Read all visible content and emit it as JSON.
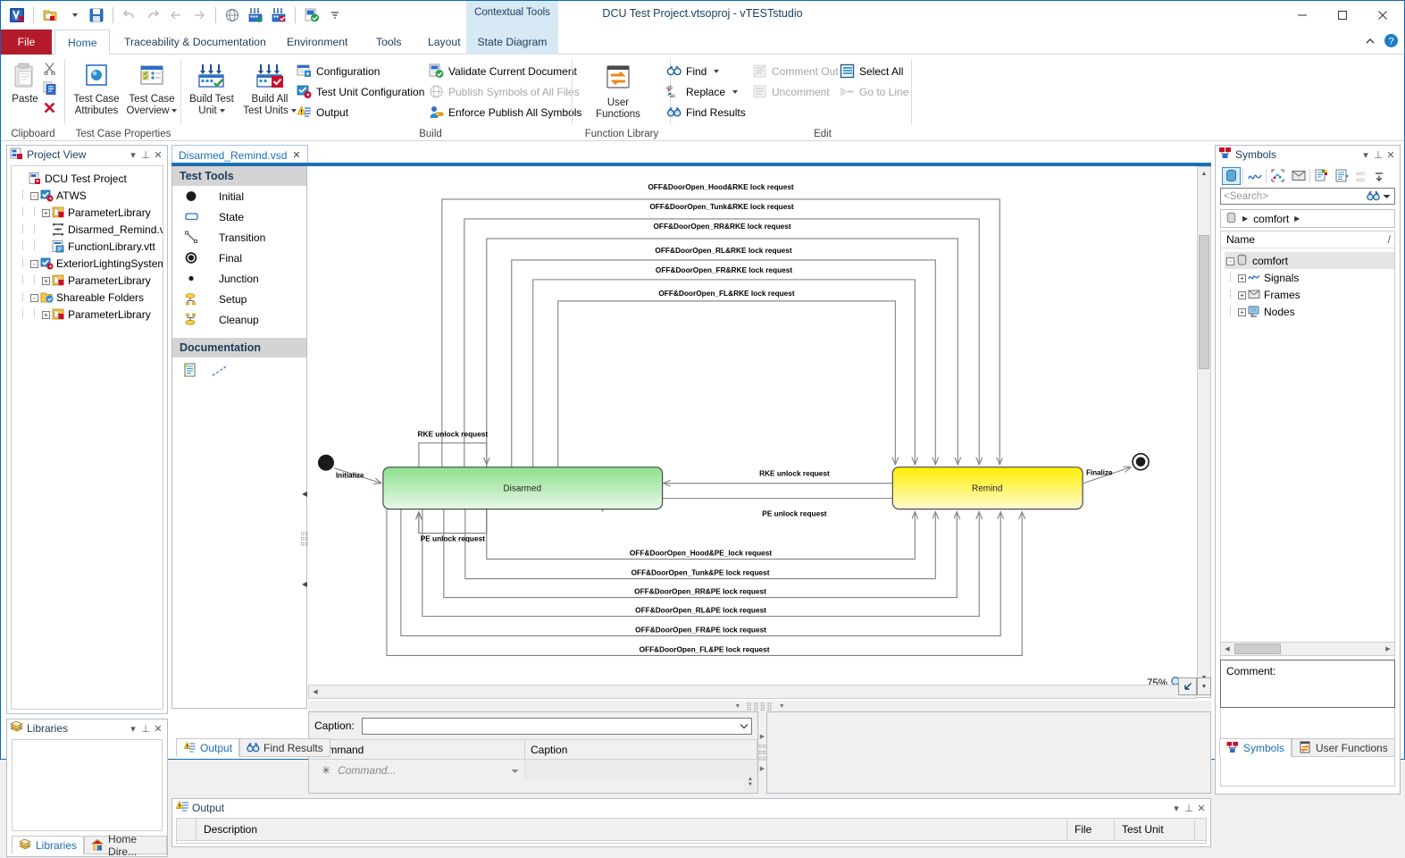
{
  "window": {
    "title": "DCU Test Project.vtsoproj - vTESTstudio",
    "contextual_tools": "Contextual Tools",
    "minimize": "—",
    "maximize": "☐",
    "close": "✕",
    "collapse_ribbon": "⌃",
    "help": "?"
  },
  "quick_access": [
    {
      "name": "app-logo-icon",
      "label": "vTESTstudio"
    },
    {
      "name": "open-project-icon",
      "label": "Open Project"
    },
    {
      "name": "save-icon",
      "label": "Save"
    },
    {
      "name": "undo-icon",
      "label": "Undo"
    },
    {
      "name": "redo-icon",
      "label": "Redo"
    },
    {
      "name": "back-icon",
      "label": "Back"
    },
    {
      "name": "forward-icon",
      "label": "Forward"
    },
    {
      "name": "publish-symbols-icon",
      "label": "Publish Symbols"
    },
    {
      "name": "build-test-unit-icon",
      "label": "Build Test Unit"
    },
    {
      "name": "build-all-test-units-icon",
      "label": "Build All Test Units"
    },
    {
      "name": "new-document-icon",
      "label": "New Document"
    },
    {
      "name": "customize-qat-icon",
      "label": "Customize Quick Access Toolbar"
    }
  ],
  "ribbon_tabs": [
    {
      "label": "File",
      "state": "file"
    },
    {
      "label": "Home",
      "state": "active"
    },
    {
      "label": "Traceability & Documentation",
      "state": "normal"
    },
    {
      "label": "Environment",
      "state": "normal"
    },
    {
      "label": "Tools",
      "state": "normal"
    },
    {
      "label": "Layout",
      "state": "normal"
    },
    {
      "label": "State Diagram",
      "state": "contextual"
    }
  ],
  "ribbon_groups": {
    "clipboard": {
      "label": "Clipboard",
      "paste": "Paste",
      "cut": "Cut",
      "copy": "Copy",
      "delete": "Delete"
    },
    "test_case_properties": {
      "label": "Test Case Properties",
      "items": [
        {
          "line1": "Test Case",
          "line2": "Attributes",
          "dropdown": false
        },
        {
          "line1": "Test Case",
          "line2": "Overview",
          "dropdown": true
        }
      ]
    },
    "build": {
      "label": "Build",
      "big": [
        {
          "line1": "Build Test",
          "line2": "Unit",
          "dropdown": true
        },
        {
          "line1": "Build All",
          "line2": "Test Units",
          "dropdown": true
        }
      ],
      "col1": [
        {
          "label": "Configuration",
          "icon": "configuration-icon",
          "disabled": false
        },
        {
          "label": "Test Unit Configuration",
          "icon": "test-unit-configuration-icon",
          "disabled": false
        },
        {
          "label": "Output",
          "icon": "output-icon",
          "disabled": false
        }
      ],
      "col2": [
        {
          "label": "Validate Current Document",
          "icon": "validate-icon",
          "disabled": false
        },
        {
          "label": "Publish Symbols of All Files",
          "icon": "publish-symbols-icon",
          "disabled": true
        },
        {
          "label": "Enforce Publish All Symbols",
          "icon": "enforce-publish-icon",
          "disabled": false
        }
      ]
    },
    "function_library": {
      "label": "Function Library",
      "user_functions_line1": "User",
      "user_functions_line2": "Functions"
    },
    "edit": {
      "label": "Edit",
      "col1": [
        {
          "label": "Find",
          "icon": "find-icon",
          "disabled": false,
          "dropdown": true
        },
        {
          "label": "Replace",
          "icon": "replace-icon",
          "disabled": false,
          "dropdown": true
        },
        {
          "label": "Find Results",
          "icon": "find-results-icon",
          "disabled": false,
          "dropdown": false
        }
      ],
      "col2": [
        {
          "label": "Comment Out",
          "icon": "comment-out-icon",
          "disabled": true
        },
        {
          "label": "Uncomment",
          "icon": "uncomment-icon",
          "disabled": true
        }
      ],
      "col3": [
        {
          "label": "Select All",
          "icon": "select-all-icon",
          "disabled": false
        },
        {
          "label": "Go to Line",
          "icon": "go-to-line-icon",
          "disabled": true
        }
      ]
    }
  },
  "project_view": {
    "title": "Project View",
    "nodes": [
      {
        "label": "DCU Test Project",
        "indent": 0,
        "expander": "",
        "icon": "project-icon"
      },
      {
        "label": "ATWS",
        "indent": 1,
        "expander": "-",
        "icon": "test-unit-icon"
      },
      {
        "label": "ParameterLibrary",
        "indent": 2,
        "expander": "+",
        "icon": "parameter-library-icon"
      },
      {
        "label": "Disarmed_Remind.vsd",
        "indent": 2,
        "expander": "",
        "icon": "state-diagram-icon"
      },
      {
        "label": "FunctionLibrary.vtt",
        "indent": 2,
        "expander": "",
        "icon": "test-table-icon"
      },
      {
        "label": "ExteriorLightingSystem",
        "indent": 1,
        "expander": "-",
        "icon": "test-unit-icon"
      },
      {
        "label": "ParameterLibrary",
        "indent": 2,
        "expander": "+",
        "icon": "parameter-library-icon"
      },
      {
        "label": "Shareable Folders",
        "indent": 1,
        "expander": "-",
        "icon": "shareable-folders-icon"
      },
      {
        "label": "ParameterLibrary",
        "indent": 2,
        "expander": "+",
        "icon": "parameter-library-icon"
      }
    ]
  },
  "libraries_panel": {
    "title": "Libraries",
    "tabs": [
      {
        "label": "Libraries",
        "icon": "libraries-icon",
        "active": true
      },
      {
        "label": "Home Dire...",
        "icon": "home-directory-icon",
        "active": false
      }
    ]
  },
  "document": {
    "tab_label": "Disarmed_Remind.vsd",
    "tab_close": "✕"
  },
  "test_tools": {
    "header": "Test Tools",
    "items": [
      {
        "label": "Initial",
        "icon": "initial-state-icon"
      },
      {
        "label": "State",
        "icon": "state-icon"
      },
      {
        "label": "Transition",
        "icon": "transition-icon"
      },
      {
        "label": "Final",
        "icon": "final-state-icon"
      },
      {
        "label": "Junction",
        "icon": "junction-icon"
      },
      {
        "label": "Setup",
        "icon": "setup-icon"
      },
      {
        "label": "Cleanup",
        "icon": "cleanup-icon"
      }
    ],
    "documentation_header": "Documentation",
    "documentation_items": [
      {
        "icon": "note-icon",
        "label": "Note"
      },
      {
        "icon": "connector-icon",
        "label": "Connector"
      }
    ]
  },
  "canvas": {
    "zoom_level": "75%",
    "zoom_icon": "magnifier-icon",
    "fit_icon": "fit-page-icon",
    "dropdown_icon": "chevron-down-icon"
  },
  "diagram": {
    "states": [
      {
        "name": "Disarmed",
        "fill": "#8fe08f"
      },
      {
        "name": "Remind",
        "fill": "#ffee00"
      }
    ],
    "pseudostates": [
      {
        "label": "Initialize",
        "type": "initial"
      },
      {
        "label": "Finalize",
        "type": "final"
      }
    ],
    "self_transitions": [
      {
        "label": "RKE unlock request",
        "on": "Disarmed",
        "side": "top"
      },
      {
        "label": "PE unlock request",
        "on": "Disarmed",
        "side": "bottom"
      }
    ],
    "remind_to_disarmed": [
      "RKE unlock request",
      "PE unlock request"
    ],
    "disarmed_to_remind_top": [
      "OFF&DoorOpen_Hood&RKE lock request",
      "OFF&DoorOpen_Tunk&RKE lock request",
      "OFF&DoorOpen_RR&RKE lock request",
      "OFF&DoorOpen_RL&RKE lock request",
      "OFF&DoorOpen_FR&RKE lock request",
      "OFF&DoorOpen_FL&RKE lock request"
    ],
    "disarmed_to_remind_bottom": [
      "OFF&DoorOpen_Hood&PE_lock request",
      "OFF&DoorOpen_Tunk&PE lock request",
      "OFF&DoorOpen_RR&PE lock request",
      "OFF&DoorOpen_RL&PE lock request",
      "OFF&DoorOpen_FR&PE lock request",
      "OFF&DoorOpen_FL&PE lock request"
    ]
  },
  "caption_editor": {
    "caption_label": "Caption:",
    "caption_value": "",
    "columns": [
      "Command",
      "Caption"
    ],
    "new_row_placeholder": "Command...",
    "new_row_marker": "✳"
  },
  "output_panel": {
    "title": "Output",
    "columns": [
      "Description",
      "File",
      "Test Unit"
    ],
    "rows": [],
    "tabs": [
      {
        "label": "Output",
        "icon": "output-icon",
        "active": true
      },
      {
        "label": "Find Results",
        "icon": "find-results-icon",
        "active": false
      }
    ]
  },
  "symbols_panel": {
    "title": "Symbols",
    "search_placeholder": "<Search>",
    "search_icon": "binoculars-icon",
    "toolbar": [
      {
        "name": "database-icon",
        "selected": true
      },
      {
        "name": "signals-icon",
        "selected": false
      },
      {
        "name": "network-nodes-icon",
        "selected": false
      },
      {
        "name": "frames-icon",
        "selected": false
      },
      {
        "name": "system-variables-icon",
        "selected": false
      },
      {
        "name": "environment-variables-icon",
        "selected": false
      },
      {
        "name": "abc-sort-icon",
        "selected": false
      },
      {
        "name": "overflow-icon",
        "selected": false
      }
    ],
    "breadcrumb": [
      "comfort"
    ],
    "breadcrumb_icon": "database-icon",
    "name_column": "Name",
    "sort_indicator": "/",
    "tree": [
      {
        "label": "comfort",
        "indent": 0,
        "expander": "-",
        "icon": "database-icon",
        "selected": true
      },
      {
        "label": "Signals",
        "indent": 1,
        "expander": "+",
        "icon": "signals-icon",
        "selected": false
      },
      {
        "label": "Frames",
        "indent": 1,
        "expander": "+",
        "icon": "frames-icon",
        "selected": false
      },
      {
        "label": "Nodes",
        "indent": 1,
        "expander": "+",
        "icon": "nodes-icon",
        "selected": false
      }
    ],
    "comment_label": "Comment:",
    "comment_value": "",
    "tabs": [
      {
        "label": "Symbols",
        "icon": "symbols-icon",
        "active": true
      },
      {
        "label": "User Functions",
        "icon": "user-functions-icon",
        "active": false
      }
    ]
  }
}
